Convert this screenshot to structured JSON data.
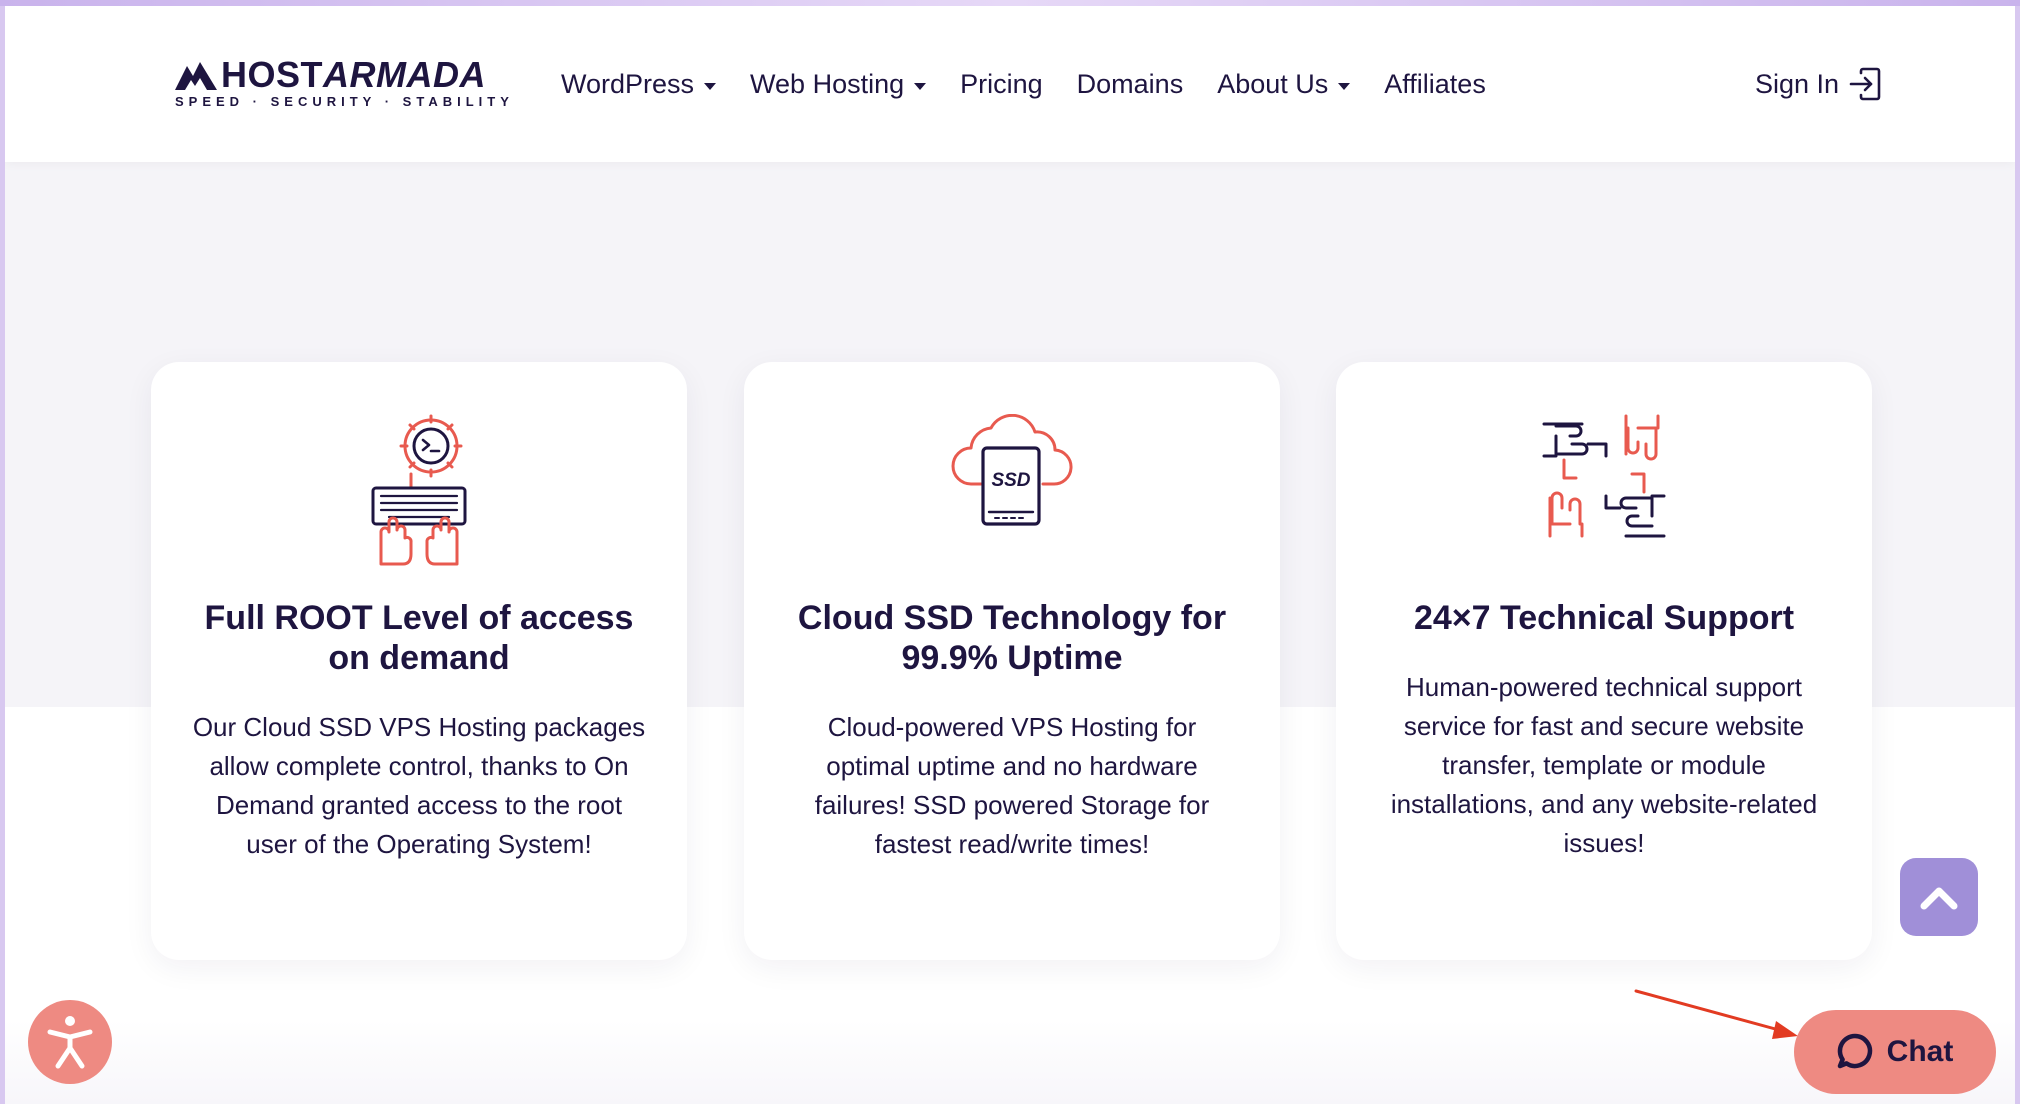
{
  "header": {
    "logo_word_a": "HOST",
    "logo_word_b": "ARMADA",
    "logo_tagline": "SPEED · SECURITY · STABILITY",
    "nav": [
      {
        "label": "WordPress",
        "dropdown": true
      },
      {
        "label": "Web Hosting",
        "dropdown": true
      },
      {
        "label": "Pricing",
        "dropdown": false
      },
      {
        "label": "Domains",
        "dropdown": false
      },
      {
        "label": "About Us",
        "dropdown": true
      },
      {
        "label": "Affiliates",
        "dropdown": false
      }
    ],
    "sign_in": "Sign In"
  },
  "features": [
    {
      "icon": "root-access-keyboard-gear-icon",
      "title": "Full ROOT Level of access on demand",
      "text": "Our Cloud SSD VPS Hosting packages allow complete control, thanks to On Demand granted access to the root user of the Operating System!"
    },
    {
      "icon": "cloud-ssd-icon",
      "title": "Cloud SSD Technology for 99.9% Uptime",
      "icon_text": "SSD",
      "text": "Cloud-powered VPS Hosting for optimal uptime and no hardware failures! SSD powered Storage for fastest read/write times!"
    },
    {
      "icon": "support-hands-icon",
      "title": "24×7 Technical Support",
      "text": "Human-powered technical support service for fast and secure website transfer, template or module installations, and any website-related issues!"
    }
  ],
  "widgets": {
    "chat_label": "Chat",
    "scroll_top_icon": "chevron-up-icon",
    "accessibility_icon": "accessibility-icon"
  },
  "colors": {
    "brand_dark": "#1e1540",
    "accent_coral": "#ee8a82",
    "accent_purple": "#a08fd8",
    "icon_red": "#e85a4f",
    "band_grey": "#f5f4f8"
  }
}
